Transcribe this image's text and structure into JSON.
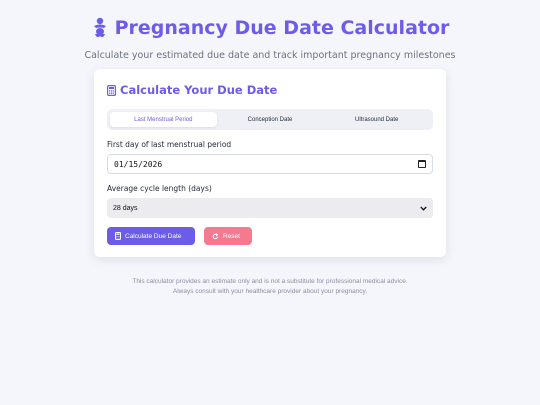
{
  "header": {
    "icon": "baby-icon",
    "title": "Pregnancy Due Date Calculator",
    "subtitle": "Calculate your estimated due date and track important pregnancy milestones"
  },
  "card": {
    "icon": "calculator-icon",
    "title": "Calculate Your Due Date",
    "tabs": [
      {
        "label": "Last Menstrual Period",
        "active": true
      },
      {
        "label": "Conception Date",
        "active": false
      },
      {
        "label": "Ultrasound Date",
        "active": false
      }
    ],
    "lmp_label": "First day of last menstrual period",
    "lmp_value": "01/15/2026",
    "cycle_label": "Average cycle length (days)",
    "cycle_value": "28 days",
    "calculate_label": "Calculate Due Date",
    "reset_label": "Reset"
  },
  "footer": {
    "line1": "This calculator provides an estimate only and is not a substitute for professional medical advice.",
    "line2": "Always consult with your healthcare provider about your pregnancy."
  },
  "colors": {
    "accent": "#6c5ce7",
    "reset": "#f47a8f",
    "background": "#f5f6fb"
  }
}
